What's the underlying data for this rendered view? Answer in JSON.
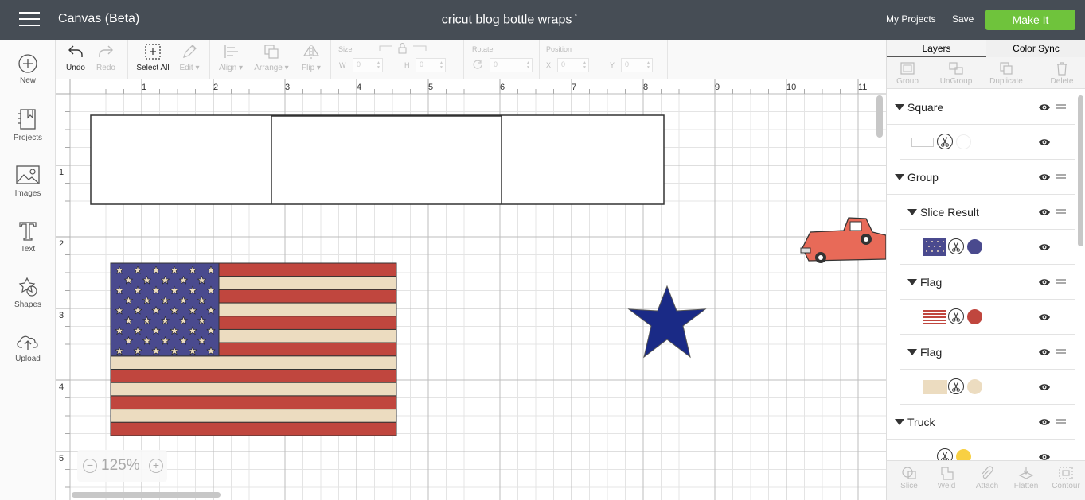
{
  "header": {
    "app_title": "Canvas (Beta)",
    "doc_title": "cricut blog bottle wraps",
    "doc_mark": "*",
    "my_projects": "My Projects",
    "save": "Save",
    "make_it": "Make It",
    "make_it_color": "#6fc33c"
  },
  "left_rail": {
    "new": "New",
    "projects": "Projects",
    "images": "Images",
    "text": "Text",
    "shapes": "Shapes",
    "upload": "Upload"
  },
  "toolbar": {
    "undo": "Undo",
    "redo": "Redo",
    "select_all": "Select All",
    "edit": "Edit",
    "align": "Align",
    "arrange": "Arrange",
    "flip": "Flip",
    "size_label": "Size",
    "w_label": "W",
    "w_value": "0",
    "h_label": "H",
    "h_value": "0",
    "rotate_label": "Rotate",
    "rotate_value": "0",
    "position_label": "Position",
    "x_label": "X",
    "x_value": "0",
    "y_label": "Y",
    "y_value": "0"
  },
  "canvas": {
    "zoom_out": "−",
    "zoom_in": "+",
    "zoom": "125%",
    "ruler_top": [
      "1",
      "2",
      "3",
      "4",
      "5",
      "6",
      "7",
      "8",
      "9",
      "10",
      "11"
    ],
    "ruler_left": [
      "1",
      "2",
      "3",
      "4",
      "5"
    ]
  },
  "panel": {
    "tab_layers": "Layers",
    "tab_color_sync": "Color Sync",
    "tools": {
      "group": "Group",
      "ungroup": "UnGroup",
      "duplicate": "Duplicate",
      "delete": "Delete"
    },
    "layers": {
      "square": "Square",
      "group": "Group",
      "slice_result": "Slice Result",
      "flag1": "Flag",
      "flag2": "Flag",
      "truck": "Truck"
    },
    "colors": {
      "square": "#ffffff",
      "slice_result": "#4a4a8e",
      "flag1": "#c0463e",
      "flag2": "#ecdcc0",
      "truck": "#f8d043"
    },
    "bottom_tools": {
      "slice": "Slice",
      "weld": "Weld",
      "attach": "Attach",
      "flatten": "Flatten",
      "contour": "Contour"
    }
  },
  "colors": {
    "topbar": "#464d55",
    "flag_red": "#c0463e",
    "flag_cream": "#ecdcc0",
    "flag_blue": "#4a4a8e",
    "star_blue": "#1a2a86",
    "truck": "#e86a58"
  }
}
